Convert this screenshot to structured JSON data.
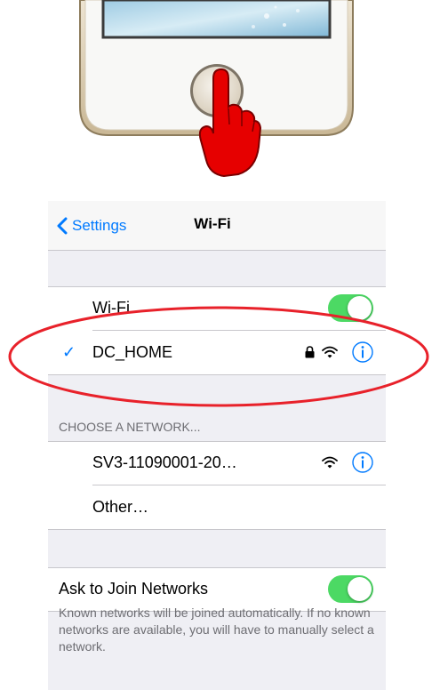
{
  "navbar": {
    "back_label": "Settings",
    "title": "Wi-Fi"
  },
  "wifi_toggle": {
    "label": "Wi-Fi",
    "on": true
  },
  "connected_network": {
    "name": "DC_HOME",
    "secured": true
  },
  "choose_section": {
    "header": "CHOOSE A NETWORK...",
    "networks": [
      {
        "name": "SV3-11090001-20…",
        "secured": false
      },
      {
        "name": "Other…"
      }
    ]
  },
  "ask_to_join": {
    "label": "Ask to Join Networks",
    "on": true,
    "footer": "Known networks will be joined automatically. If no known networks are available, you will have to manually select a network."
  },
  "colors": {
    "accent": "#007aff",
    "toggle_on": "#4cd964",
    "highlight_ring": "#e8212a",
    "hand": "#e60000"
  },
  "icons": [
    "chevron-left-icon",
    "checkmark-icon",
    "lock-icon",
    "wifi-icon",
    "info-icon",
    "pointing-hand-icon",
    "home-button-icon"
  ]
}
